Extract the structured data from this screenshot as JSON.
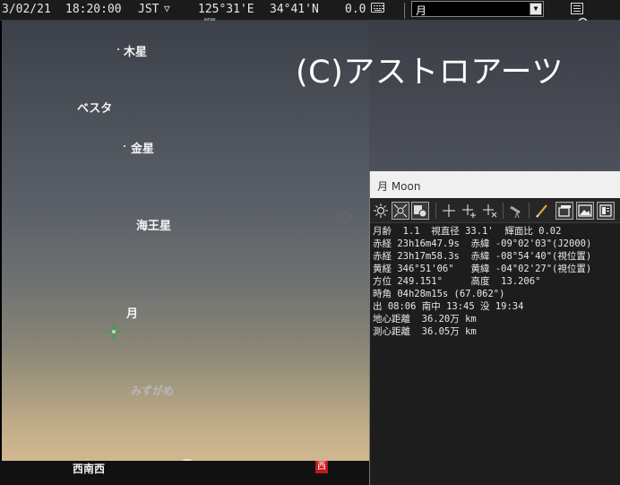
{
  "toolbar": {
    "date": "3/02/21",
    "time": "18:20:00",
    "timezone": "JST",
    "tz_arrow": "▽",
    "longitude": "125°31'E",
    "latitude": "34°41'N",
    "altitude": "0.0",
    "search_value": "月",
    "icons": [
      "now-clock-icon",
      "keyboard-icon",
      "dropdown-arrow-icon",
      "search-icon",
      "menu-icon"
    ]
  },
  "sky": {
    "labels": {
      "jupiter": "木星",
      "vesta": "ベスタ",
      "venus": "金星",
      "neptune": "海王星",
      "moon": "月",
      "mizugame": "みずがめ"
    },
    "copyright": "(C)アストロアーツ",
    "direction": "西南西",
    "west_marker": "西"
  },
  "panel": {
    "title": "月 Moon",
    "lines": [
      "月齢  1.1  視直径 33.1'  輝面比 0.02",
      "赤経 23h16m47.9s  赤緯 -09°02'03\"(J2000)",
      "赤経 23h17m58.3s  赤緯 -08°54'40\"(視位置)",
      "黄経 346°51'06\"   黄緯 -04°02'27\"(視位置)",
      "方位 249.151°     高度  13.206°",
      "時角 04h28m15s (67.062°)",
      "出 08:06 南中 13:45 没 19:34",
      "地心距離  36.20万 km",
      "測心距離  36.05万 km"
    ],
    "tools": [
      "sun-icon",
      "target-icon",
      "planet-icon",
      "crosshair-icon",
      "crosshair-plus-icon",
      "crosshair-x-icon",
      "telescope-icon",
      "pencil-icon",
      "window-icon",
      "image-icon",
      "book-icon"
    ]
  },
  "colors": {
    "west_marker": "#c4171c",
    "cursor": "#3aa34a"
  }
}
